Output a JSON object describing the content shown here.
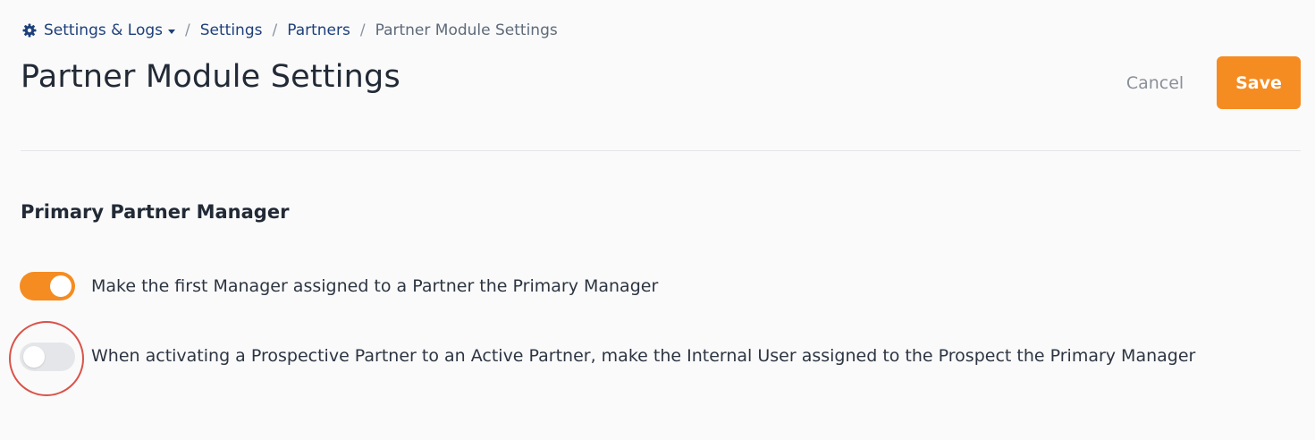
{
  "breadcrumb": {
    "root_icon": "gear-icon",
    "root_label": "Settings & Logs",
    "root_caret": "caret-down-icon",
    "items": [
      {
        "label": "Settings"
      },
      {
        "label": "Partners"
      }
    ],
    "current": "Partner Module Settings",
    "separator": "/"
  },
  "header": {
    "title": "Partner Module Settings",
    "cancel_label": "Cancel",
    "save_label": "Save"
  },
  "section": {
    "title": "Primary Partner Manager",
    "options": [
      {
        "label": "Make the first Manager assigned to a Partner the Primary Manager",
        "enabled": true
      },
      {
        "label": "When activating a Prospective Partner to an Active Partner, make the Internal User assigned to the Prospect the Primary Manager",
        "enabled": false
      }
    ]
  },
  "colors": {
    "accent": "#f58c21",
    "link": "#1d3f7a",
    "toggle_off": "#e4e6e9",
    "annotation": "#d9534a"
  }
}
